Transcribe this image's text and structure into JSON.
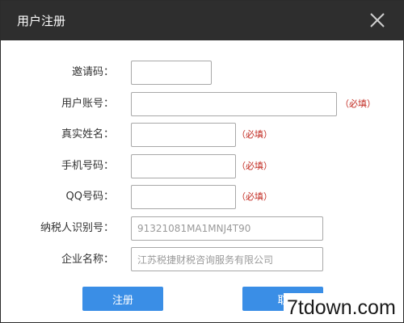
{
  "window": {
    "title": "用户注册",
    "close_icon": "close-icon"
  },
  "form": {
    "invite_code": {
      "label": "邀请码：",
      "value": ""
    },
    "account": {
      "label": "用户账号：",
      "value": "",
      "required": "（必填）"
    },
    "real_name": {
      "label": "真实姓名：",
      "value": "",
      "required": "（必填）"
    },
    "phone": {
      "label": "手机号码：",
      "value": "",
      "required": "（必填）"
    },
    "qq": {
      "label": "QQ号码：",
      "value": "",
      "required": "（必填）"
    },
    "tax_id": {
      "label": "纳税人识别号：",
      "value": "91321081MA1MNJ4T90"
    },
    "company": {
      "label": "企业名称：",
      "value": "江苏税捷财税咨询服务有限公司"
    }
  },
  "buttons": {
    "register": "注册",
    "cancel": "取"
  },
  "watermark": "7tdown.com",
  "colors": {
    "titlebar": "#2e2e2e",
    "accent": "#3a8ee6",
    "required": "#c0261d"
  }
}
